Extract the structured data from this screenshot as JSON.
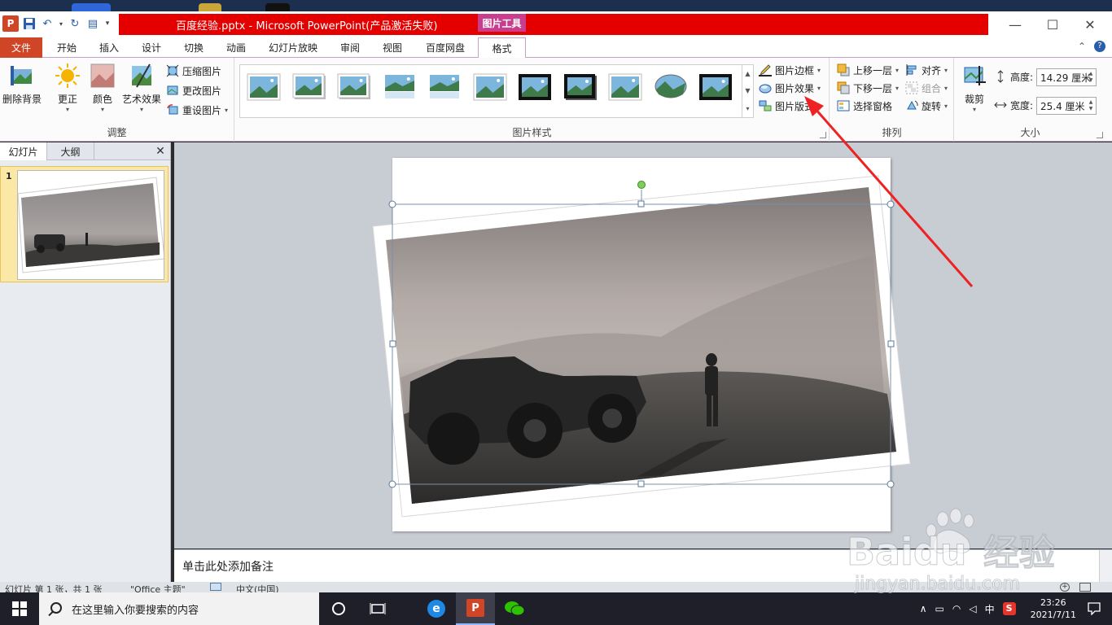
{
  "window": {
    "title": "百度经验.pptx  -  Microsoft PowerPoint(产品激活失败)",
    "context_tab_header": "图片工具",
    "minimize": "—",
    "maximize": "☐",
    "close": "✕"
  },
  "ribbon_tabs": [
    "文件",
    "开始",
    "插入",
    "设计",
    "切换",
    "动画",
    "幻灯片放映",
    "审阅",
    "视图",
    "百度网盘",
    "格式"
  ],
  "active_tab": "格式",
  "ribbon": {
    "adjust_group": {
      "label": "调整",
      "remove_bg": "删除背景",
      "corrections": "更正",
      "color": "颜色",
      "artistic": "艺术效果",
      "compress": "压缩图片",
      "change": "更改图片",
      "reset": "重设图片"
    },
    "styles_group": {
      "label": "图片样式",
      "border": "图片边框",
      "effects": "图片效果",
      "layout": "图片版式"
    },
    "arrange_group": {
      "label": "排列",
      "bring_forward": "上移一层",
      "send_backward": "下移一层",
      "selection_pane": "选择窗格",
      "align": "对齐",
      "group": "组合",
      "rotate": "旋转"
    },
    "size_group": {
      "label": "大小",
      "crop": "裁剪",
      "height_label": "高度:",
      "height_value": "14.29 厘米",
      "width_label": "宽度:",
      "width_value": "25.4 厘米"
    }
  },
  "left_pane": {
    "tab_slides": "幻灯片",
    "tab_outline": "大纲",
    "close": "✕",
    "slide_number": "1"
  },
  "notes_placeholder": "单击此处添加备注",
  "statusbar": {
    "slide_info": "幻灯片 第 1 张，共 1 张",
    "theme": "\"Office 主题\"",
    "language": "中文(中国)"
  },
  "taskbar": {
    "search_placeholder": "在这里输入你要搜索的内容",
    "ime": "中",
    "time": "23:26",
    "date": "2021/7/11"
  },
  "watermark": {
    "brand": "Baidu",
    "product": "经验",
    "url": "jingyan.baidu.com"
  },
  "colors": {
    "title_bar": "#e50000",
    "file_tab": "#d04525",
    "context_tab": "#c83e8e",
    "annotation_arrow": "#ee2222",
    "thumb_selected": "#fce8a6"
  }
}
